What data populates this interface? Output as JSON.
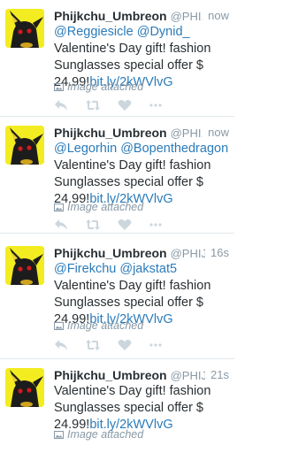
{
  "tweets": [
    {
      "name": "Phijkchu_Umbreon",
      "handle": "@PHI...",
      "time": "now",
      "mentions": [
        "@Reggiesicle",
        "@Dynid_"
      ],
      "text": "Valentine's Day gift! fashion Sunglasses special offer $ 24.99!",
      "link": "bit.ly/2kWVlvG",
      "attachment": "Image attached"
    },
    {
      "name": "Phijkchu_Umbreon",
      "handle": "@PHI...",
      "time": "now",
      "mentions": [
        "@Legorhin",
        "@Bopenthedragon"
      ],
      "text": "Valentine's Day gift! fashion Sunglasses special offer $ 24.99!",
      "link": "bit.ly/2kWVlvG",
      "attachment": "Image attached"
    },
    {
      "name": "Phijkchu_Umbreon",
      "handle": "@PHIJ...",
      "time": "16s",
      "mentions": [
        "@Firekchu",
        "@jakstat5"
      ],
      "text": "Valentine's Day gift! fashion Sunglasses special offer $ 24.99!",
      "link": "bit.ly/2kWVlvG",
      "attachment": "Image attached"
    },
    {
      "name": "Phijkchu_Umbreon",
      "handle": "@PHIJ...",
      "time": "21s",
      "mentions": [],
      "text": "Valentine's Day gift! fashion Sunglasses special offer $ 24.99!",
      "link": "bit.ly/2kWVlvG",
      "attachment": "Image attached"
    }
  ],
  "icons": {
    "avatar": "umbreon-avatar",
    "attachment": "image-icon",
    "actions": [
      "reply-icon",
      "retweet-icon",
      "like-icon",
      "more-icon"
    ]
  },
  "colors": {
    "link": "#2b7bb9",
    "muted": "#8899a6",
    "text": "#292f33",
    "action_icon": "#ccd6dd",
    "avatar_bg": "#f3ec21"
  }
}
